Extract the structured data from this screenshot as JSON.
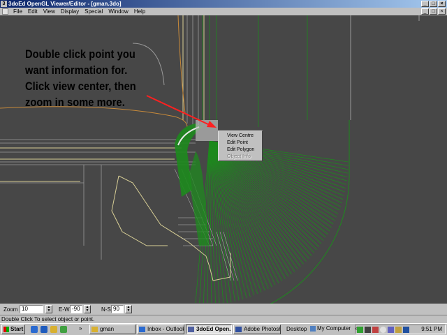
{
  "window": {
    "title": "3doEd OpenGL Viewer/Editor - [gman.3do]",
    "app_icon": "3d-app-icon",
    "buttons": [
      "minimize",
      "maximize",
      "close"
    ]
  },
  "menubar": {
    "items": [
      "File",
      "Edit",
      "View",
      "Display",
      "Special",
      "Window",
      "Help"
    ]
  },
  "annotation": {
    "lines": [
      "Double click point you",
      "want information for.",
      "Click view center, then",
      "zoom in some more."
    ],
    "arrow_color": "#ff2020"
  },
  "context_menu": {
    "items": [
      {
        "label": "View Centre",
        "enabled": true
      },
      {
        "label": "Edit Point",
        "enabled": true
      },
      {
        "label": "Edit Polygon",
        "enabled": true
      },
      {
        "label": "Object Info",
        "enabled": false
      }
    ]
  },
  "controls": {
    "zoom_label": "Zoom",
    "zoom_value": "10",
    "ew_label": "E-W",
    "ew_value": "-90",
    "ns_label": "N-S",
    "ns_value": "90"
  },
  "status": {
    "text": "Double Click To select object or point."
  },
  "taskbar": {
    "start_label": "Start",
    "buttons": [
      {
        "label": "gman",
        "active": false
      },
      {
        "label": "Inbox - Outlook...",
        "active": false
      },
      {
        "label": "3doEd Open...",
        "active": true
      },
      {
        "label": "Adobe Photosh...",
        "active": false
      }
    ],
    "desktop_label": "Desktop",
    "mycomputer_label": "My Computer",
    "clock": "9:51 PM"
  },
  "colors": {
    "viewport_bg": "#474747",
    "mesh_green": "#1d8a1d",
    "wire_gray": "#9a9a9a",
    "wire_yellow": "#d8cf96",
    "wire_orange": "#c88a3a"
  }
}
